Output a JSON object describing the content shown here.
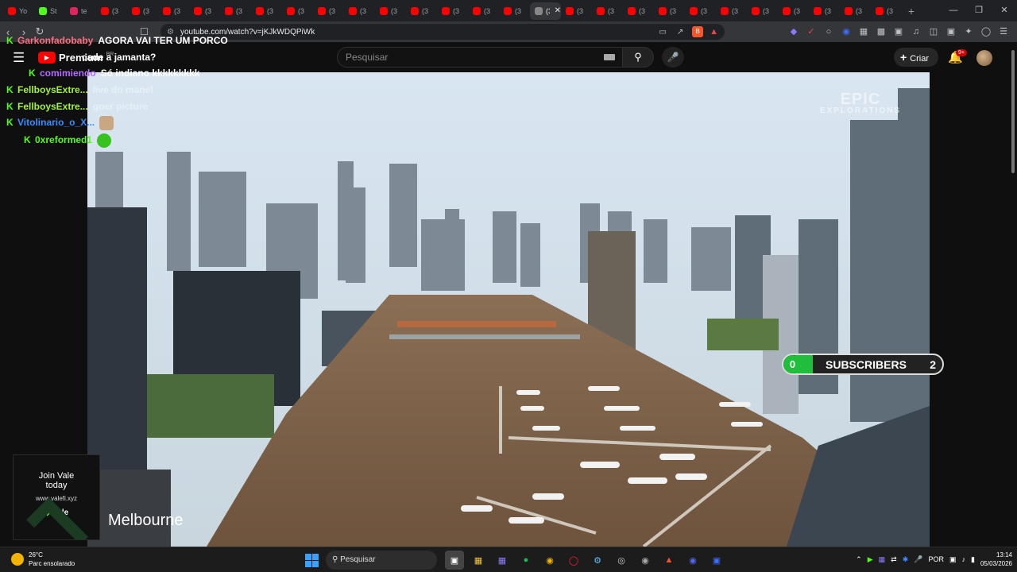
{
  "browser": {
    "tabs": [
      {
        "label": "Yo",
        "color": "#ff0000"
      },
      {
        "label": "St",
        "color": "#53fc18"
      },
      {
        "label": "te",
        "color": "#e0245e"
      },
      {
        "label": "(3",
        "color": "#ff0000"
      },
      {
        "label": "(3",
        "color": "#ff0000"
      },
      {
        "label": "(3",
        "color": "#ff0000"
      },
      {
        "label": "(3",
        "color": "#ff0000"
      },
      {
        "label": "(3",
        "color": "#ff0000"
      },
      {
        "label": "(3",
        "color": "#ff0000"
      },
      {
        "label": "(3",
        "color": "#ff0000"
      },
      {
        "label": "(3",
        "color": "#ff0000"
      },
      {
        "label": "(3",
        "color": "#ff0000"
      },
      {
        "label": "(3",
        "color": "#ff0000"
      },
      {
        "label": "(3",
        "color": "#ff0000"
      },
      {
        "label": "(3",
        "color": "#ff0000"
      },
      {
        "label": "(3",
        "color": "#ff0000"
      },
      {
        "label": "(3",
        "color": "#ff0000"
      },
      {
        "label": "(3",
        "color": "#888888",
        "active": true
      },
      {
        "label": "(3",
        "color": "#ff0000"
      },
      {
        "label": "(3",
        "color": "#ff0000"
      },
      {
        "label": "(3",
        "color": "#ff0000"
      },
      {
        "label": "(3",
        "color": "#ff0000"
      },
      {
        "label": "(3",
        "color": "#ff0000"
      },
      {
        "label": "(3",
        "color": "#ff0000"
      },
      {
        "label": "(3",
        "color": "#ff0000"
      },
      {
        "label": "(3",
        "color": "#ff0000"
      },
      {
        "label": "(3",
        "color": "#ff0000"
      },
      {
        "label": "(3",
        "color": "#ff0000"
      },
      {
        "label": "(3",
        "color": "#ff0000"
      }
    ],
    "new_tab": "+",
    "url": "youtube.com/watch?v=jKJkWDQPiWk"
  },
  "youtube": {
    "logo_text": "Premium",
    "logo_country": "BR",
    "search_placeholder": "Pesquisar",
    "create_label": "Criar",
    "notif_count": "9+"
  },
  "video": {
    "caption": "Melbourne",
    "watermark_line1": "EPIC",
    "watermark_line2": "EXPLORATIONS",
    "subs_count": "0",
    "subs_label": "SUBSCRIBERS",
    "subs_goal": "2"
  },
  "chat": [
    {
      "user": "Garkonfadobaby",
      "text": "AGORA VAI TER UM PORCO",
      "color": "#ff6b81",
      "badge": true
    },
    {
      "user": "",
      "text": "cade a jamanta?",
      "color": "#ffffff",
      "badge": false
    },
    {
      "user": "comimiendo",
      "text": "Só indiano kkkkkkkkk",
      "color": "#b36bff",
      "badge": true
    },
    {
      "user": "FellboysExtre...",
      "text": "live do manel",
      "color": "#a4f23a",
      "badge": true
    },
    {
      "user": "FellboysExtre...",
      "text": "goer picture",
      "color": "#a4f23a",
      "badge": true
    },
    {
      "user": "Vitolinario_o_X...",
      "text": "",
      "color": "#3b8cff",
      "badge": true,
      "emote": "cat"
    },
    {
      "user": "0xreformed1",
      "text": "",
      "color": "#53fc18",
      "badge": true,
      "emote": "frog"
    }
  ],
  "ad": {
    "line1": "Join Vale",
    "line2": "today",
    "site": "www.valefi.xyz",
    "brand": "Vale"
  },
  "taskbar": {
    "weather_temp": "26°C",
    "weather_desc": "Parc ensolarado",
    "search_label": "Pesquisar",
    "lang": "POR",
    "time": "13:14",
    "date": "05/03/2026"
  }
}
